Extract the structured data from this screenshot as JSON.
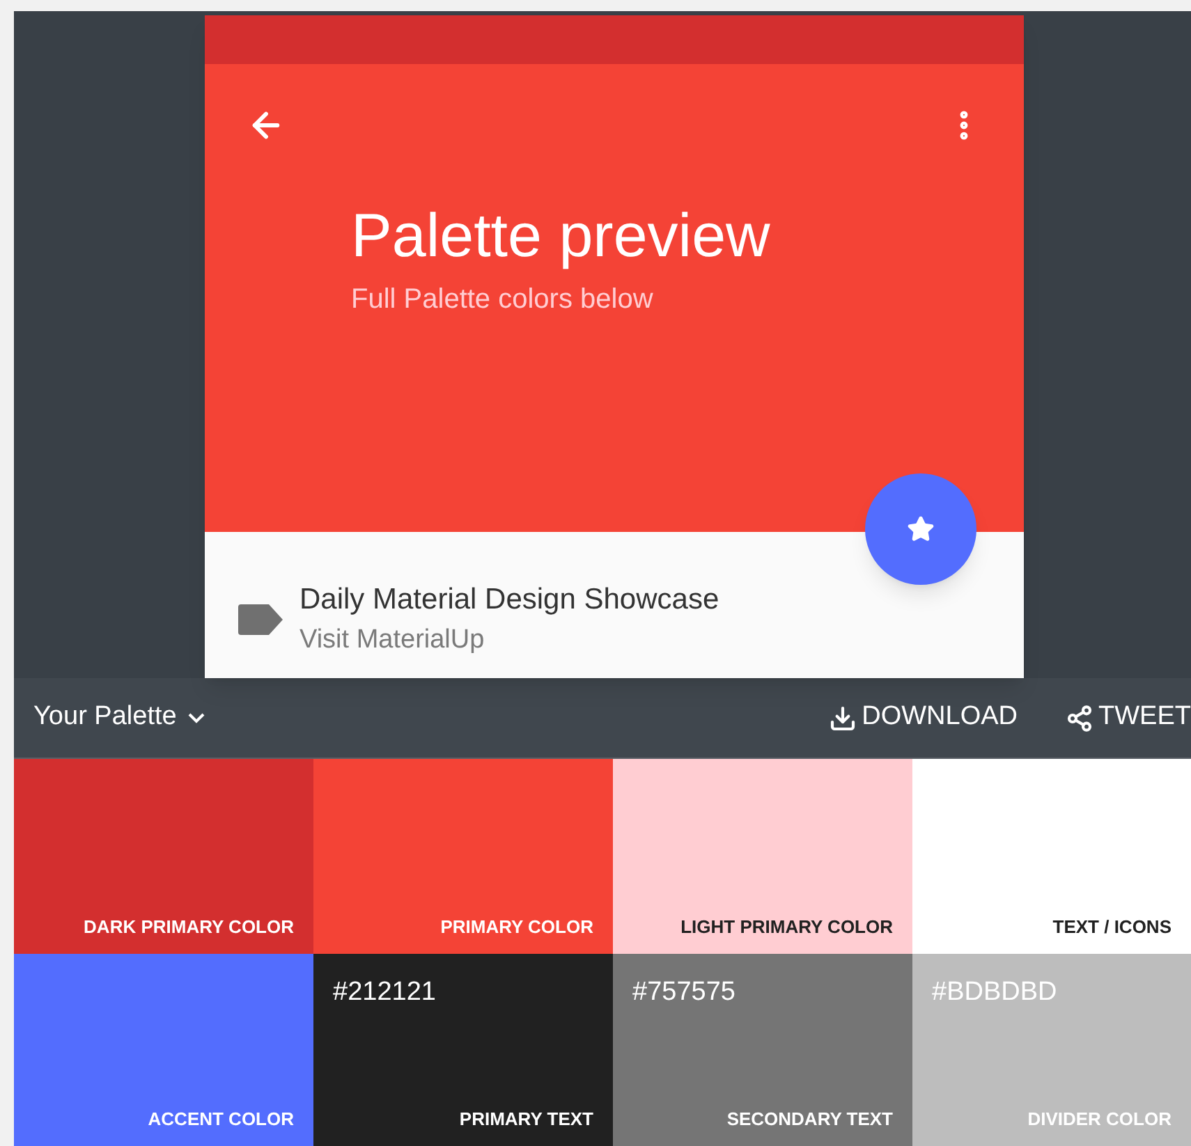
{
  "preview": {
    "title": "Palette preview",
    "subtitle": "Full Palette colors below",
    "card_title": "Daily Material Design Showcase",
    "card_link": "Visit MaterialUp"
  },
  "palette_bar": {
    "title": "Your Palette",
    "actions": [
      {
        "kind": "download",
        "label": "DOWNLOAD"
      },
      {
        "kind": "share",
        "label": "TWEET"
      }
    ]
  },
  "swatches": [
    {
      "kind": "light",
      "color": "#d32f2f",
      "label": "DARK PRIMARY COLOR"
    },
    {
      "kind": "light",
      "color": "#f44336",
      "label": "PRIMARY COLOR"
    },
    {
      "kind": "dark",
      "color": "#ffcdd2",
      "label": "LIGHT PRIMARY COLOR"
    },
    {
      "kind": "dark",
      "color": "#ffffff",
      "label": "TEXT / ICONS"
    },
    {
      "kind": "light",
      "color": "#536dfe",
      "label": "ACCENT COLOR"
    },
    {
      "kind": "light",
      "color": "#212121",
      "hex": "#212121",
      "label": "PRIMARY TEXT"
    },
    {
      "kind": "light",
      "color": "#757575",
      "hex": "#757575",
      "label": "SECONDARY TEXT"
    },
    {
      "kind": "light",
      "color": "#bdbdbd",
      "hex": "#BDBDBD",
      "label": "DIVIDER COLOR"
    }
  ]
}
